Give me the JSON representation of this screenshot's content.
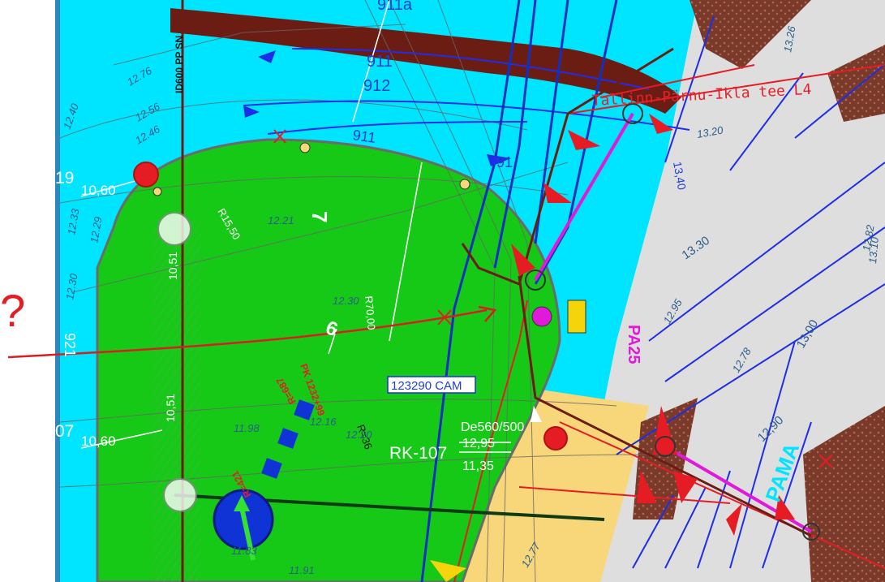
{
  "annotation": {
    "question_mark": "?"
  },
  "labels": {
    "cam_box": "123290 CAM",
    "rk_name": "RK-107",
    "rk_pipe": "De560/500",
    "rk_top": "12,95",
    "rk_bottom": "11,35",
    "node_19": "19",
    "node_19_level": "10,60",
    "node_07": "07",
    "node_07_level": "10,60",
    "pipe_vertical": "ID600 PP SN",
    "road_name": "Tallinn-Pärnu-Ikla tee L4",
    "parking_code": "PA25",
    "radius_1": "R15,50",
    "radius_2": "R70,00",
    "radius_3": "R=36",
    "station_1": "R=687",
    "station_2": "PK 1232+99",
    "station_3": "R=421",
    "section_7": "7",
    "section_6": "6",
    "lane_911": "911",
    "lane_911a": "911a",
    "lane_912": "912",
    "lane_91": "91",
    "v_105": "10,51",
    "v_1051b": "10,51",
    "v_921": "921",
    "v_1330": "13.30",
    "v_1340": "13,40",
    "v_1300": "13,00",
    "v_1290": "12,90",
    "v_1295": "12.95",
    "v_1320": "13.20",
    "pama": "PAMA",
    "e_1221": "12.21",
    "e_1230": "12.30",
    "e_1198": "11.98",
    "e_1216": "12.16",
    "e_1220": "12.20",
    "e_1183": "11.83",
    "e_1191": "11.91",
    "e_1278": "12.78",
    "e_1277": "12.77",
    "e_1326": "13.26",
    "e_1229": "12.29",
    "e_1233": "12.33",
    "e_1240": "12.40",
    "e_1246": "12.46",
    "e_1256": "12.56",
    "e_1276": "12.76",
    "e_1230b": "12.30",
    "e_1282": "12.82",
    "e_1310": "13.10"
  },
  "colors": {
    "grass": "#17c917",
    "water_blue": "#00e5ff",
    "asphalt": "#dedede",
    "sand": "#f8d77a",
    "drive": "#6b1d14",
    "brick": "#7a3a2a",
    "line_blue": "#1e2ee8",
    "line_red": "#e61c24",
    "magenta": "#e01ad8",
    "road_sign_blue": "#1033d6"
  }
}
